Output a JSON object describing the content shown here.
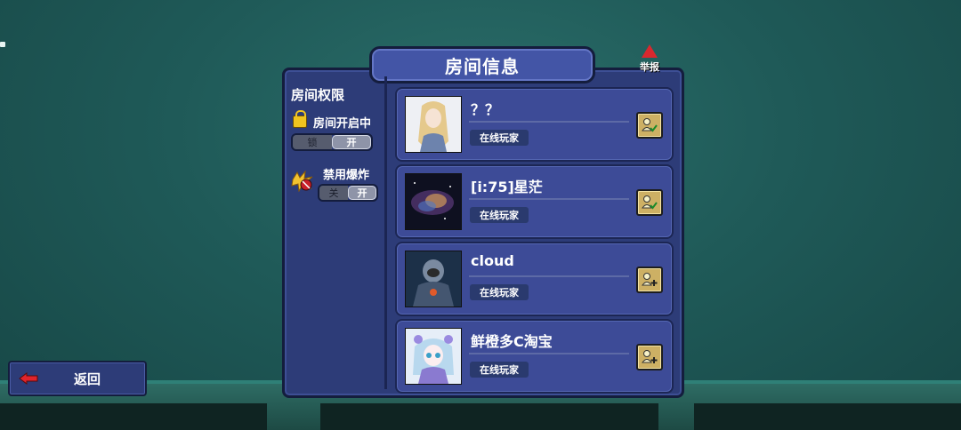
{
  "window": {
    "title": "房间信息",
    "report_label": "举报"
  },
  "permissions": {
    "heading": "房间权限",
    "room_status": {
      "label": "房间开启中",
      "toggle_off": "锁",
      "toggle_on": "开",
      "state": "on"
    },
    "explosions": {
      "label": "禁用爆炸",
      "toggle_off": "关",
      "toggle_on": "开",
      "state": "on"
    }
  },
  "players": [
    {
      "name": "？？",
      "status": "在线玩家",
      "action_icon": "user-check-icon"
    },
    {
      "name": "[i:75]星茫",
      "status": "在线玩家",
      "action_icon": "user-check-icon"
    },
    {
      "name": "cloud",
      "status": "在线玩家",
      "action_icon": "user-add-icon"
    },
    {
      "name": "鲜橙多C淘宝",
      "status": "在线玩家",
      "action_icon": "user-add-icon"
    }
  ],
  "back_button": {
    "label": "返回"
  },
  "colors": {
    "panel": "#2d3c78",
    "card": "#3d4b97",
    "title_tab": "#4355a6",
    "report": "#d8282e",
    "action_button": "#cdb064"
  }
}
